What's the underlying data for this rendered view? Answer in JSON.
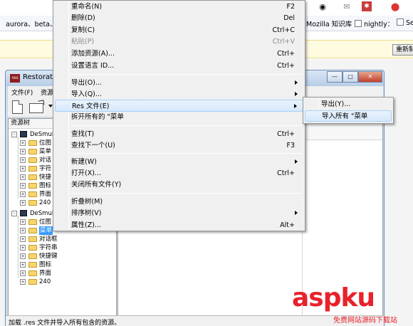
{
  "browser": {
    "bookmarks": [
      "aurora、beta、",
      "Mozilla 知识库",
      "nightly：",
      "Se"
    ],
    "notify_button": "重新制"
  },
  "app": {
    "title": "Restorator",
    "menubar": [
      "文件(F)",
      "资源"
    ],
    "tree_header": "资源树",
    "tree_root_1": "DeSmuMe",
    "tree_items_1": [
      "位图",
      "菜单",
      "对话",
      "字符",
      "快捷",
      "图标",
      "界面",
      "240"
    ],
    "tree_root_2": "DeSmuMe",
    "tree_items_2": [
      "位图",
      "菜单",
      "对话框",
      "字符串",
      "快捷键",
      "图标",
      "界面",
      "240"
    ],
    "status": "加载 .res 文件并导入所有包含的资源。"
  },
  "context_menu": {
    "items": [
      {
        "label": "重命名(N)",
        "shortcut": "F2"
      },
      {
        "label": "删除(D)",
        "shortcut": "Del"
      },
      {
        "label": "复制(C)",
        "shortcut": "Ctrl+C"
      },
      {
        "label": "粘贴(P)",
        "shortcut": "Ctrl+V",
        "disabled": true
      },
      {
        "label": "添加资源(A)...",
        "shortcut": "Ctrl+"
      },
      {
        "label": "设置语言 ID...",
        "shortcut": "Ctrl+"
      },
      {
        "label": "导出(O)...",
        "submenu": true
      },
      {
        "label": "导入(Q)...",
        "submenu": true
      },
      {
        "label": "Res 文件(E)",
        "submenu": true,
        "highlighted": true
      },
      {
        "label": "拆开所有的 \"菜单"
      },
      {
        "label": "查找(T)",
        "shortcut": "Ctrl+"
      },
      {
        "label": "查找下一个(U)",
        "shortcut": "F3"
      },
      {
        "label": "新建(W)",
        "submenu": true
      },
      {
        "label": "打开(X)...",
        "shortcut": "Ctrl+"
      },
      {
        "label": "关闭所有文件(Y)"
      },
      {
        "label": "折叠树(M)"
      },
      {
        "label": "排序树(V)",
        "submenu": true
      },
      {
        "label": "属性(Z)...",
        "shortcut": "Alt+"
      }
    ]
  },
  "submenu": {
    "items": [
      {
        "label": "导出(Y)..."
      },
      {
        "label": "导入所有 \"菜单",
        "highlighted": true
      }
    ]
  },
  "watermark": {
    "brand": "aspku",
    "tagline": "免费网站源码下载站"
  },
  "colors": {
    "selection": "#3399ff",
    "menu_bg": "#f0f0f0",
    "watermark": "#e8212a"
  }
}
